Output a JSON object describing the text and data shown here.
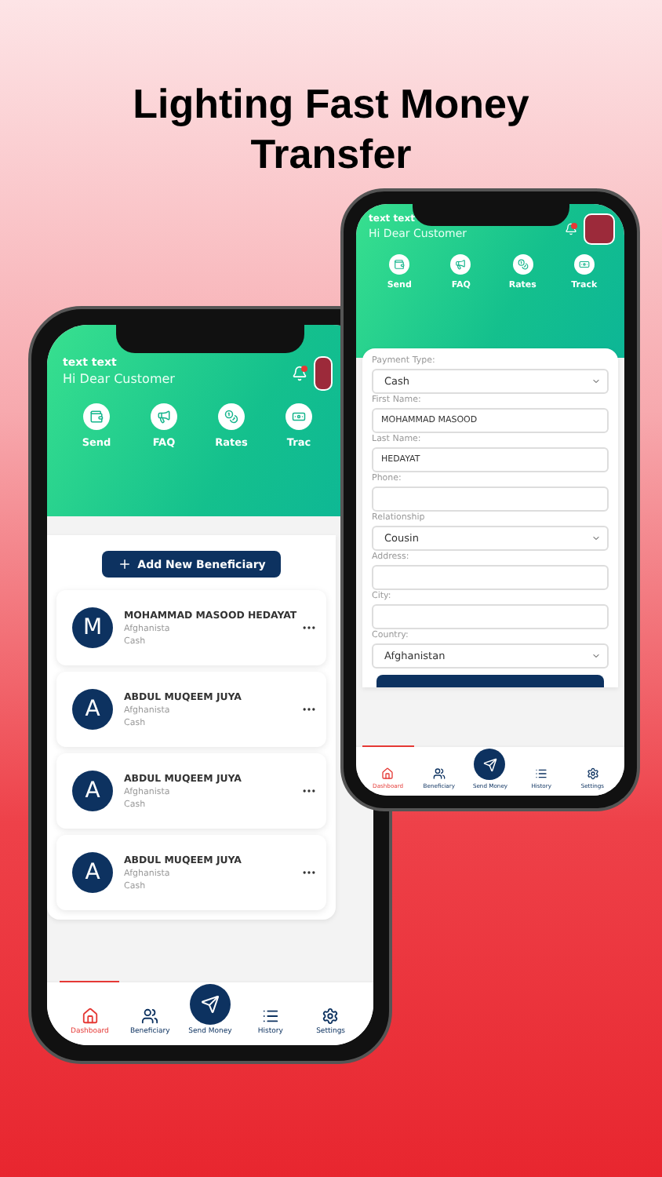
{
  "headline": "Lighting Fast Money Transfer",
  "phones": [
    {
      "kind": "list",
      "overline": "text text",
      "greeting": "Hi Dear Customer",
      "notification": true,
      "quick_actions": [
        {
          "label": "Send"
        },
        {
          "label": "FAQ"
        },
        {
          "label": "Rates"
        },
        {
          "label": "Trac"
        }
      ],
      "add_button": "Add New Beneficiary",
      "beneficiaries": [
        {
          "initial": "M",
          "name": "MOHAMMAD MASOOD HEDAYAT",
          "country": "Afghanista",
          "method": "Cash"
        },
        {
          "initial": "A",
          "name": "ABDUL MUQEEM JUYA",
          "country": "Afghanista",
          "method": "Cash"
        },
        {
          "initial": "A",
          "name": "ABDUL MUQEEM JUYA",
          "country": "Afghanista",
          "method": "Cash"
        },
        {
          "initial": "A",
          "name": "ABDUL MUQEEM JUYA",
          "country": "Afghanista",
          "method": "Cash"
        }
      ],
      "nav": [
        {
          "label": "Dashboard",
          "selected": true
        },
        {
          "label": "Beneficiary",
          "selected": false
        },
        {
          "label": "Send Money",
          "selected": false
        },
        {
          "label": "History",
          "selected": false
        },
        {
          "label": "Settings",
          "selected": false
        }
      ]
    },
    {
      "kind": "form",
      "overline": "text text",
      "greeting": "Hi Dear Customer",
      "notification": true,
      "quick_actions": [
        {
          "label": "Send"
        },
        {
          "label": "FAQ"
        },
        {
          "label": "Rates"
        },
        {
          "label": "Track"
        }
      ],
      "fields": [
        {
          "kind": "select",
          "label": "Payment Type:",
          "value": "Cash"
        },
        {
          "kind": "input",
          "label": "First Name:",
          "value": "MOHAMMAD MASOOD"
        },
        {
          "kind": "input",
          "label": "Last Name:",
          "value": "HEDAYAT"
        },
        {
          "kind": "input",
          "label": "Phone:"
        },
        {
          "kind": "select",
          "label": "Relationship",
          "value": "Cousin"
        },
        {
          "kind": "input",
          "label": "Address:"
        },
        {
          "kind": "input",
          "label": "City:"
        },
        {
          "kind": "select",
          "label": "Country:",
          "value": "Afghanistan"
        }
      ],
      "nav": [
        {
          "label": "Dashboard",
          "selected": true
        },
        {
          "label": "Beneficiary",
          "selected": false
        },
        {
          "label": "Send Money",
          "selected": false
        },
        {
          "label": "History",
          "selected": false
        },
        {
          "label": "Settings",
          "selected": false
        }
      ]
    }
  ]
}
